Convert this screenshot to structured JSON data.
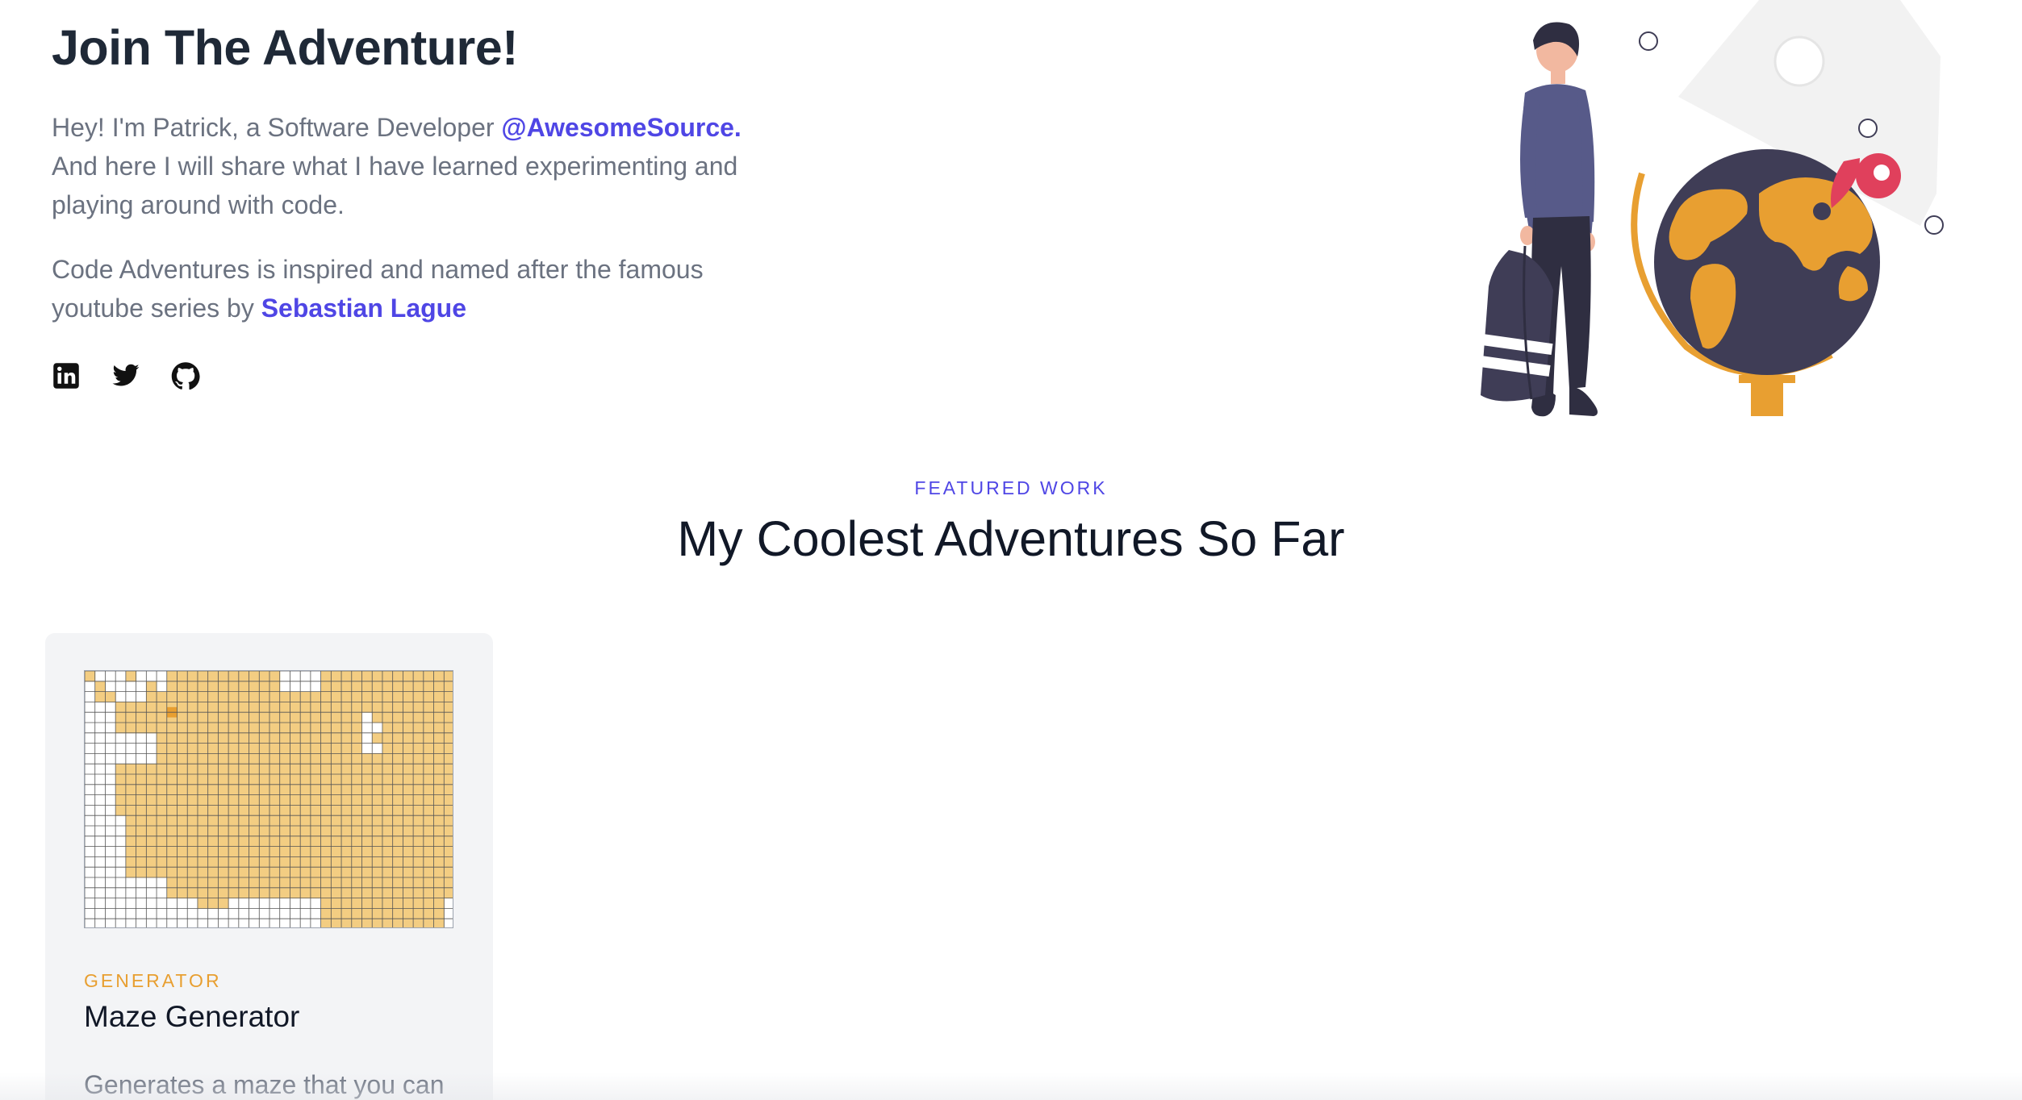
{
  "hero": {
    "title": "Join The Adventure!",
    "intro_before": "Hey! I'm Patrick, a Software Developer ",
    "company_link": "@AwesomeSource.",
    "intro_after": " And here I will share what I have learned experimenting and playing around with code.",
    "inspired_before": "Code Adventures is inspired and named after the famous youtube series by ",
    "inspired_link": "Sebastian Lague"
  },
  "socials": [
    {
      "name": "linkedin-icon"
    },
    {
      "name": "twitter-icon"
    },
    {
      "name": "github-icon"
    }
  ],
  "featured": {
    "eyebrow": "FEATURED WORK",
    "title": "My Coolest Adventures So Far"
  },
  "cards": [
    {
      "category": "GENERATOR",
      "title": "Maze Generator",
      "description": "Generates a maze that you can"
    }
  ],
  "colors": {
    "accent": "#4f46e5",
    "category": "#e89f31",
    "maze_fill": "#f3cd82",
    "maze_current": "#e89f31",
    "globe_dark": "#3f3d56",
    "jacket": "#575a89",
    "pin": "#e0405c"
  }
}
